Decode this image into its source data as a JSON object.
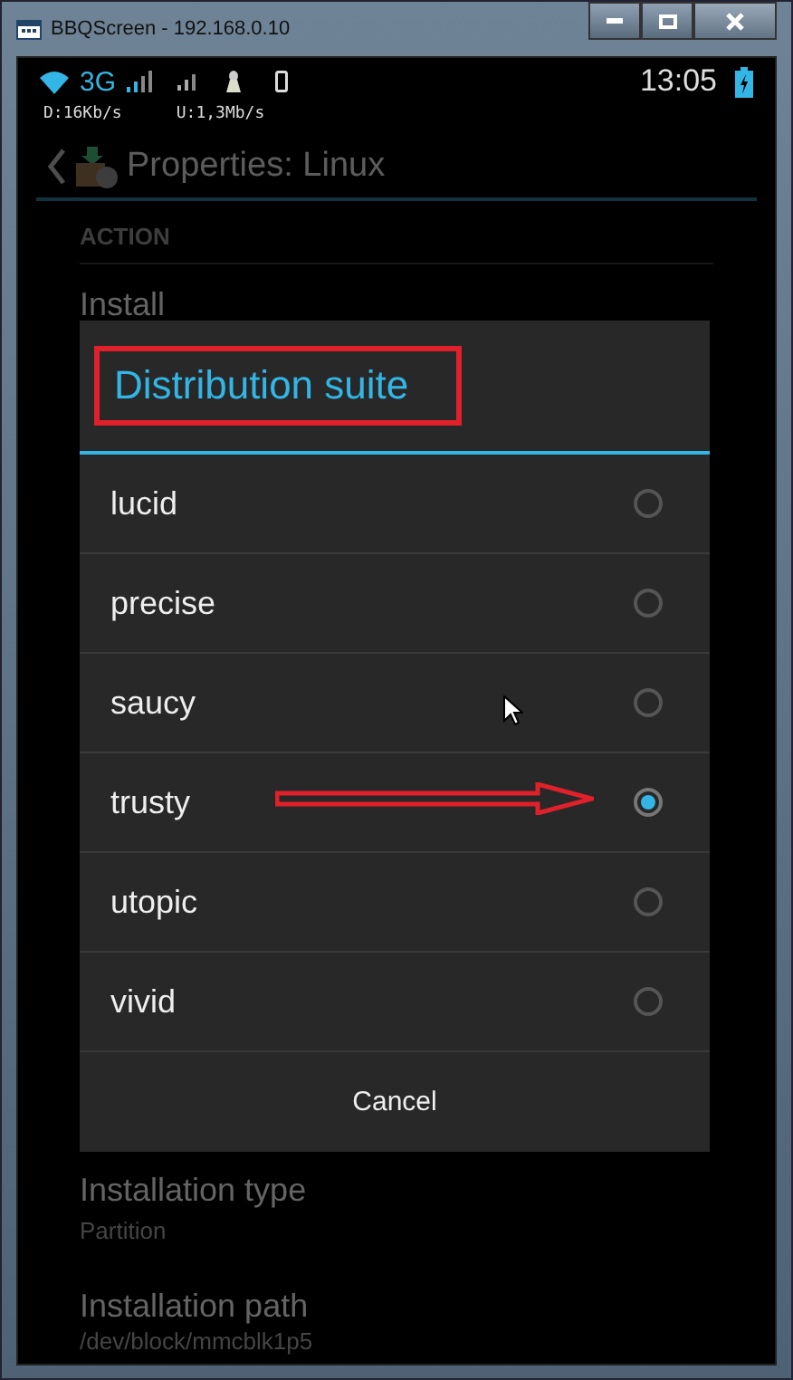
{
  "window": {
    "title": "BBQScreen - 192.168.0.10"
  },
  "status_bar": {
    "network": "3G",
    "time": "13:05",
    "download": "D:16Kb/s",
    "upload": "U:1,3Mb/s"
  },
  "action_bar": {
    "title": "Properties: Linux"
  },
  "settings": {
    "section": "ACTION",
    "items": [
      {
        "title": "Install"
      },
      {
        "title": "Installation type",
        "summary": "Partition"
      },
      {
        "title": "Installation path",
        "summary": "/dev/block/mmcblk1p5"
      }
    ]
  },
  "dialog": {
    "title": "Distribution suite",
    "options": [
      {
        "label": "lucid",
        "selected": false
      },
      {
        "label": "precise",
        "selected": false
      },
      {
        "label": "saucy",
        "selected": false
      },
      {
        "label": "trusty",
        "selected": true
      },
      {
        "label": "utopic",
        "selected": false
      },
      {
        "label": "vivid",
        "selected": false
      }
    ],
    "cancel": "Cancel"
  }
}
